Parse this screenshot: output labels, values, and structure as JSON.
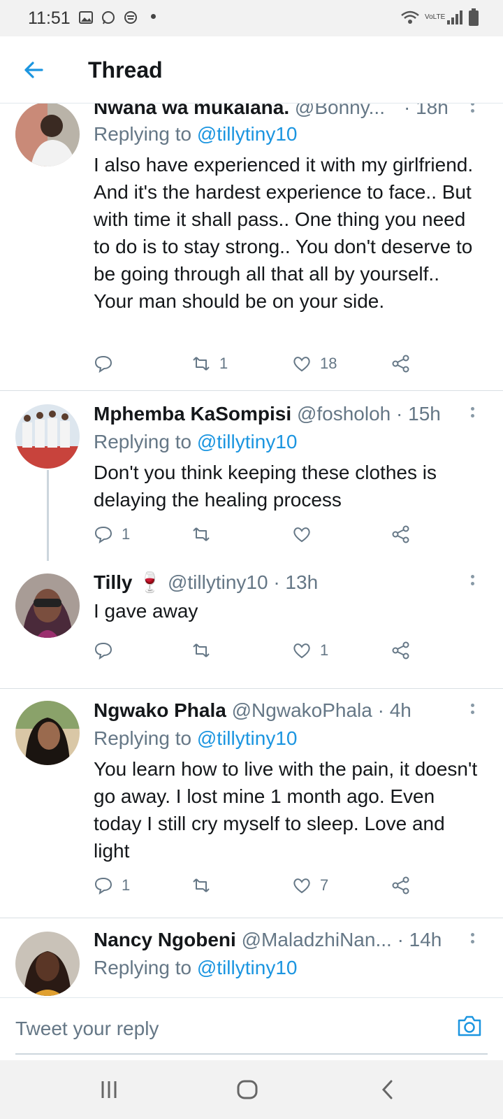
{
  "status_bar": {
    "time": "11:51",
    "network_label": "VoLTE"
  },
  "header": {
    "title": "Thread"
  },
  "tweets": [
    {
      "name": "Nwana wa mukalana.",
      "handle": "@Bonny...",
      "time": "· 18h",
      "replying_prefix": "Replying to ",
      "replying_to": "@tillytiny10",
      "text": "I also have experienced it with my girlfriend. And it's the hardest experience to face.. But with time it shall pass.. One thing you need to do is to stay strong.. You don't deserve to be going through all that all by yourself.. Your man should be on your side.",
      "replies": "",
      "retweets": "1",
      "likes": "18"
    },
    {
      "name": "Mphemba KaSompisi",
      "handle": "@fosholoh",
      "time": "· 15h",
      "replying_prefix": "Replying to ",
      "replying_to": "@tillytiny10",
      "text": "Don't you think keeping these clothes is delaying the healing process",
      "replies": "1",
      "retweets": "",
      "likes": ""
    },
    {
      "name": "Tilly",
      "emoji": "🍷",
      "handle": "@tillytiny10",
      "time": "· 13h",
      "text": "I gave away",
      "replies": "",
      "retweets": "",
      "likes": "1"
    },
    {
      "name": "Ngwako Phala",
      "handle": "@NgwakoPhala",
      "time": "· 4h",
      "replying_prefix": "Replying to ",
      "replying_to": "@tillytiny10",
      "text": "You learn how to live with the pain, it doesn't go away. I lost mine 1 month ago. Even today I still cry myself to sleep. Love and light",
      "replies": "1",
      "retweets": "",
      "likes": "7"
    },
    {
      "name": "Nancy Ngobeni",
      "handle": "@MaladzhiNan...",
      "time": "· 14h",
      "replying_prefix": "Replying to ",
      "replying_to": "@tillytiny10"
    }
  ],
  "reply_bar": {
    "placeholder": "Tweet your reply"
  },
  "colors": {
    "accent": "#1b95e0",
    "secondary_text": "#657786",
    "divider": "#d9dfe3"
  },
  "icons": [
    "back-arrow-icon",
    "reply-icon",
    "retweet-icon",
    "like-icon",
    "share-icon",
    "more-icon",
    "camera-icon",
    "recents-icon",
    "home-icon",
    "back-icon"
  ]
}
